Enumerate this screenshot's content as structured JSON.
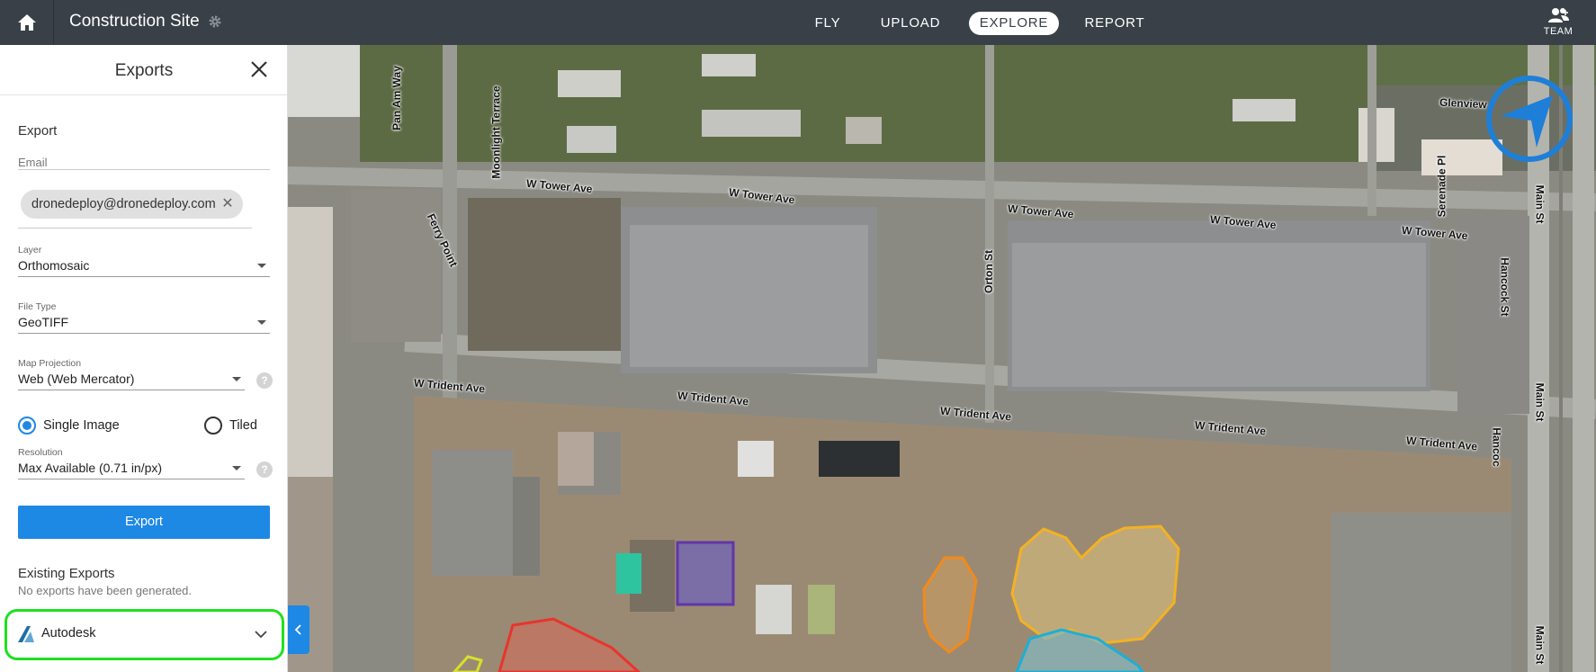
{
  "topbar": {
    "site_title": "Construction Site",
    "nav": [
      {
        "label": "FLY"
      },
      {
        "label": "UPLOAD"
      },
      {
        "label": "EXPLORE",
        "active": true
      },
      {
        "label": "REPORT"
      }
    ],
    "team_label": "TEAM",
    "icons": {
      "home": "home-icon",
      "settings": "gear-icon",
      "team": "team-icon"
    }
  },
  "sidebar": {
    "title": "Exports",
    "export_heading": "Export",
    "email_label": "Email",
    "email_chip": "dronedeploy@dronedeploy.com",
    "layer_label": "Layer",
    "layer_value": "Orthomosaic",
    "filetype_label": "File Type",
    "filetype_value": "GeoTIFF",
    "projection_label": "Map Projection",
    "projection_value": "Web (Web Mercator)",
    "single_image_label": "Single Image",
    "tiled_label": "Tiled",
    "resolution_label": "Resolution",
    "resolution_value": "Max Available (0.71 in/px)",
    "export_button": "Export",
    "existing_heading": "Existing Exports",
    "existing_empty": "No exports have been generated.",
    "autodesk_label": "Autodesk",
    "help_glyph": "?"
  },
  "map": {
    "streets": [
      "Pan Am Way",
      "Moonlight Terrace",
      "Ferry Point",
      "W Tower Ave",
      "W Tower Ave",
      "W Tower Ave",
      "W Tower Ave",
      "W Tower Ave",
      "Orton St",
      "Glenview",
      "Serenade Pl",
      "Hancock St",
      "Main St",
      "Main St",
      "Main St",
      "W Trident Ave",
      "W Trident Ave",
      "W Trident Ave",
      "W Trident Ave",
      "W Trident Ave",
      "Hancoc"
    ],
    "accent_color": "#1e88e5"
  }
}
